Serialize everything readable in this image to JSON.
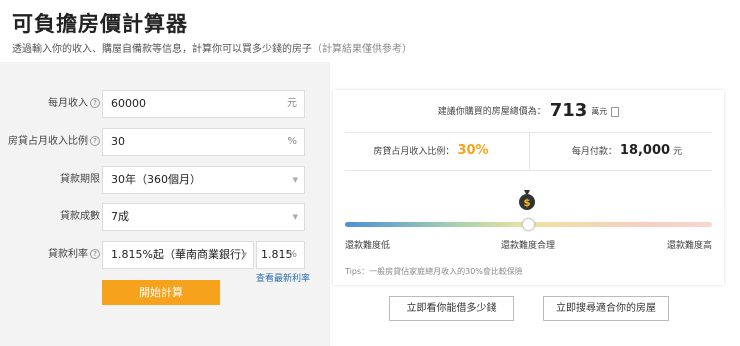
{
  "header": {
    "title": "可負擔房價計算器",
    "subtitle": "透過輸入你的收入、購屋自備款等信息，計算你可以買多少錢的房子",
    "subtitle_note": "（計算結果僅供參考）"
  },
  "form": {
    "income": {
      "label": "每月收入",
      "value": "60000",
      "unit": "元"
    },
    "ratio": {
      "label": "房貸占月收入比例",
      "value": "30",
      "unit": "%"
    },
    "term": {
      "label": "貸款期限",
      "value": "30年（360個月）"
    },
    "loan_pct": {
      "label": "貸款成數",
      "value": "7成"
    },
    "rate": {
      "label": "貸款利率",
      "value": "1.815%起（華南商業銀行）",
      "rate_value": "1.815",
      "unit": "%"
    },
    "latest_rate_link": "查看最新利率",
    "calc_button": "開始計算"
  },
  "result": {
    "total_label": "建議你購買的房屋總價為：",
    "total_value": "713",
    "total_unit": "萬元",
    "ratio_label": "房貸占月收入比例：",
    "ratio_value": "30%",
    "monthly_label": "每月付款：",
    "monthly_value": "18,000",
    "monthly_unit": "元",
    "difficulty": {
      "low": "還款難度低",
      "mid": "還款難度合理",
      "high": "還款難度高"
    },
    "difficulty_level": 0.5,
    "tips": "Tips：一般房貸佔家庭總月收入的30%會比較保險"
  },
  "actions": {
    "borrow_button": "立即看你能借多少錢",
    "search_button": "立即搜尋適合你的房屋"
  },
  "colors": {
    "accent": "#f7a21c",
    "link": "#2b6cb0"
  }
}
